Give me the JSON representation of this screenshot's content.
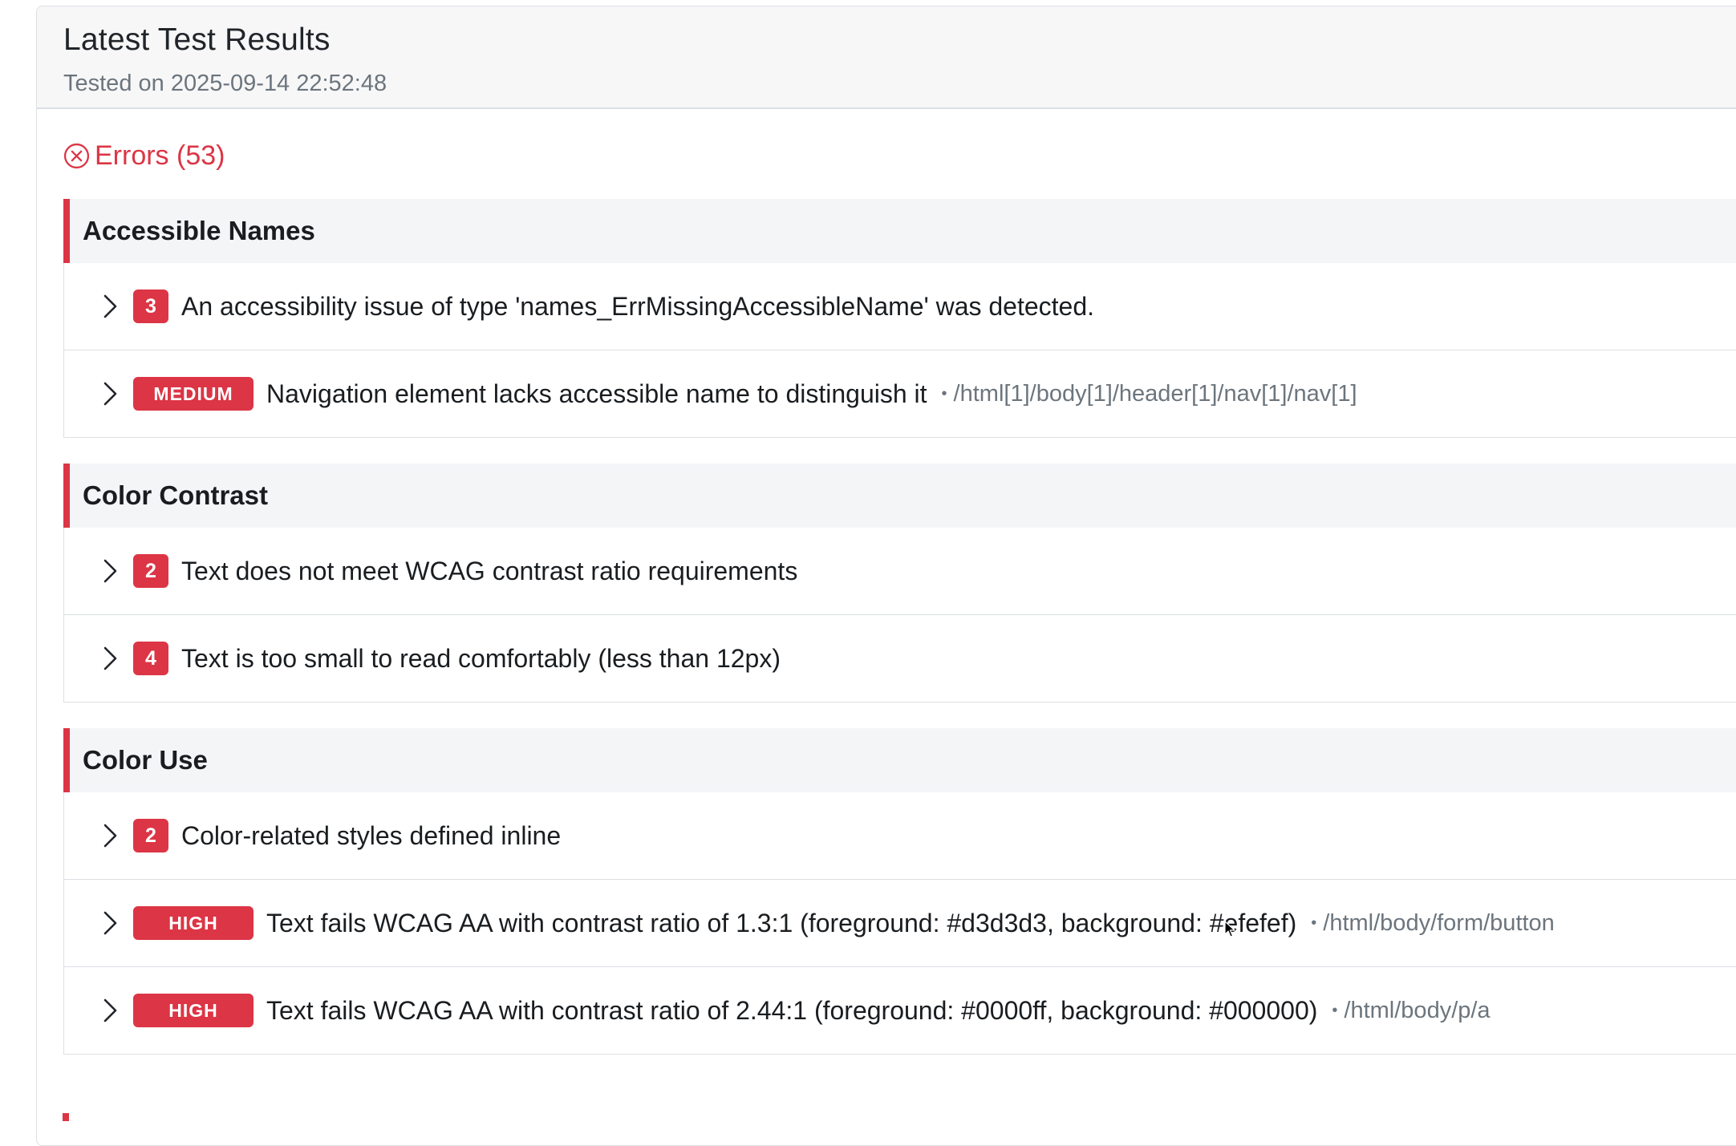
{
  "header": {
    "title": "Latest Test Results",
    "subtitle": "Tested on 2025-09-14 22:52:48"
  },
  "errors": {
    "label": "Errors (53)",
    "icon": "x-circle-icon",
    "color": "#dc3545"
  },
  "groups": [
    {
      "title": "Accessible Names",
      "items": [
        {
          "badge": "3",
          "message": "An accessibility issue of type 'names_ErrMissingAccessibleName' was detected.",
          "path": ""
        },
        {
          "badge": "MEDIUM",
          "message": "Navigation element lacks accessible name to distinguish it",
          "separator": "•",
          "path": "/html[1]/body[1]/header[1]/nav[1]/nav[1]"
        }
      ]
    },
    {
      "title": "Color Contrast",
      "items": [
        {
          "badge": "2",
          "message": "Text does not meet WCAG contrast ratio requirements",
          "path": ""
        },
        {
          "badge": "4",
          "message": "Text is too small to read comfortably (less than 12px)",
          "path": ""
        }
      ]
    },
    {
      "title": "Color Use",
      "items": [
        {
          "badge": "2",
          "message": "Color-related styles defined inline",
          "path": ""
        },
        {
          "badge": "HIGH",
          "message": "Text fails WCAG AA with contrast ratio of 1.3:1 (foreground: #d3d3d3, background: #efefef)",
          "separator": "•",
          "path": "/html/body/form/button"
        },
        {
          "badge": "HIGH",
          "message": "Text fails WCAG AA with contrast ratio of 2.44:1 (foreground: #0000ff, background: #000000)",
          "separator": "•",
          "path": "/html/body/p/a"
        }
      ]
    }
  ],
  "colors": {
    "accent_red": "#dc3545",
    "muted_text": "#6c757d",
    "header_bg": "#f7f7f8"
  }
}
